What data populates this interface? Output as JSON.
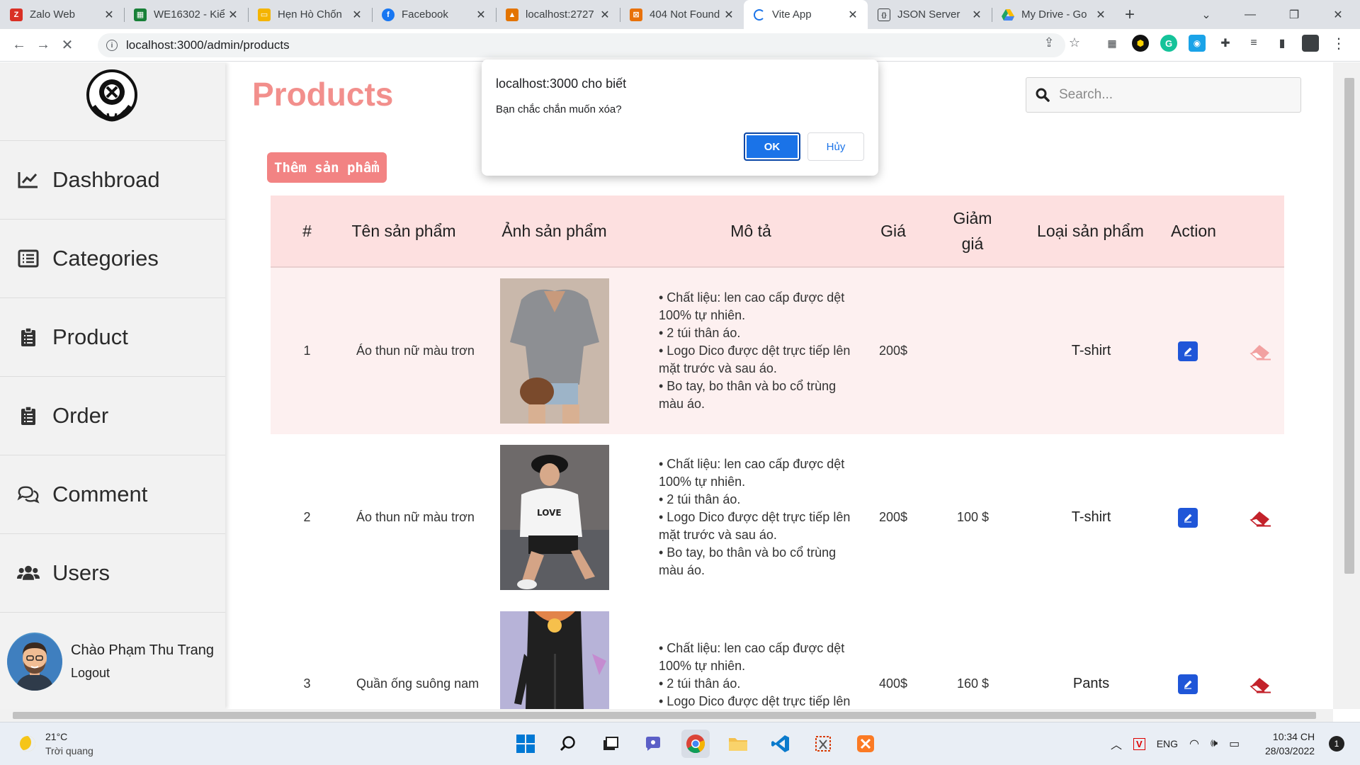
{
  "browser": {
    "tabs": [
      {
        "title": "Zalo Web",
        "fav_color": "#d93025",
        "fav_glyph": "Z"
      },
      {
        "title": "WE16302 - Kiể",
        "fav_color": "#188038",
        "fav_glyph": "▦"
      },
      {
        "title": "Hẹn Hò Chốn",
        "fav_color": "#f4b400",
        "fav_glyph": "▭"
      },
      {
        "title": "Facebook",
        "fav_color": "#1877f2",
        "fav_glyph": "f"
      },
      {
        "title": "localhost:2727",
        "fav_color": "#e37400",
        "fav_glyph": "▲"
      },
      {
        "title": "404 Not Found",
        "fav_color": "#e8710a",
        "fav_glyph": "⊠"
      },
      {
        "title": "Vite App",
        "fav_color": "#ffffff",
        "fav_glyph": "◌"
      },
      {
        "title": "JSON Server",
        "fav_color": "#ffffff",
        "fav_glyph": "{}"
      },
      {
        "title": "My Drive - Go",
        "fav_color": "#ffffff",
        "fav_glyph": "▲"
      }
    ],
    "active_tab": 6,
    "url": "localhost:3000/admin/products"
  },
  "sidebar": {
    "items": [
      {
        "label": "Dashbroad",
        "icon": "chart-line-icon"
      },
      {
        "label": "Categories",
        "icon": "list-icon"
      },
      {
        "label": "Product",
        "icon": "clipboard-list-icon"
      },
      {
        "label": "Order",
        "icon": "clipboard-list-icon"
      },
      {
        "label": "Comment",
        "icon": "comments-icon"
      },
      {
        "label": "Users",
        "icon": "users-icon"
      }
    ],
    "user": {
      "greeting": "Chào Phạm Thu Trang",
      "logout": "Logout"
    }
  },
  "main": {
    "title": "Products",
    "search_placeholder": "Search...",
    "add_button": "Thêm sản phẩm",
    "table": {
      "headers": [
        "#",
        "Tên sản phẩm",
        "Ảnh sản phẩm",
        "Mô tả",
        "Giá",
        "Giảm giá",
        "Loại sản phẩm",
        "Action"
      ],
      "rows": [
        {
          "id": "1",
          "name": "Áo thun nữ màu trơn",
          "desc": "• Chất liệu: len cao cấp được dệt 100% tự nhiên.\n• 2 túi thân áo.\n• Logo Dico được dệt trực tiếp lên mặt trước và sau áo.\n• Bo tay, bo thân và bo cổ trùng màu áo.",
          "price": "200$",
          "discount": "",
          "category": "T-shirt"
        },
        {
          "id": "2",
          "name": "Áo thun nữ màu trơn",
          "desc": "• Chất liệu: len cao cấp được dệt 100% tự nhiên.\n• 2 túi thân áo.\n• Logo Dico được dệt trực tiếp lên mặt trước và sau áo.\n• Bo tay, bo thân và bo cổ trùng màu áo.",
          "price": "200$",
          "discount": "100 $",
          "category": "T-shirt"
        },
        {
          "id": "3",
          "name": "Quần ống suông nam",
          "desc": "• Chất liệu: len cao cấp được dệt 100% tự nhiên.\n• 2 túi thân áo.\n• Logo Dico được dệt trực tiếp lên mặt trước và sau áo.",
          "price": "400$",
          "discount": "160 $",
          "category": "Pants"
        }
      ]
    }
  },
  "dialog": {
    "title": "localhost:3000 cho biết",
    "message": "Bạn chắc chắn muốn xóa?",
    "ok": "OK",
    "cancel": "Hủy"
  },
  "taskbar": {
    "temp": "21°C",
    "condition": "Trời quang",
    "lang": "ENG",
    "time": "10:34 CH",
    "date": "28/03/2022",
    "notifications": "1"
  },
  "colors": {
    "accent": "#f28f8c",
    "header_bg": "#fde0e0",
    "edit": "#1f56d8",
    "delete": "#c3222b",
    "ok": "#1a73e8"
  }
}
